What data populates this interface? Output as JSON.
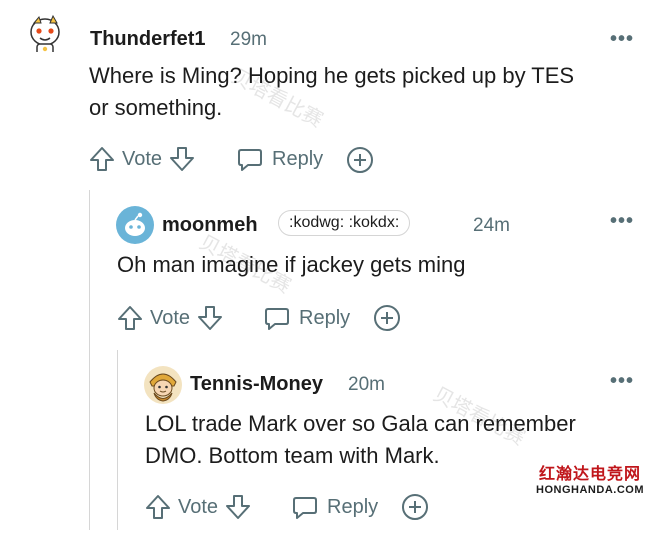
{
  "comments": [
    {
      "author": "Thunderfet1",
      "time": "29m",
      "avatar_icon": "snoo-avatar-icon",
      "text_lines": [
        "Where is Ming? Hoping he gets picked up by TES",
        "or something."
      ],
      "vote_label": "Vote",
      "reply_label": "Reply"
    },
    {
      "author": "moonmeh",
      "flair": ":kodwg: :kokdx:",
      "time": "24m",
      "avatar_icon": "default-snoo-avatar-icon",
      "text_lines": [
        "Oh man imagine if jackey gets ming"
      ],
      "vote_label": "Vote",
      "reply_label": "Reply"
    },
    {
      "author": "Tennis-Money",
      "time": "20m",
      "avatar_icon": "character-avatar-icon",
      "text_lines": [
        "LOL trade Mark over so Gala can remember",
        "DMO. Bottom team with Mark."
      ],
      "vote_label": "Vote",
      "reply_label": "Reply"
    }
  ],
  "watermarks": [
    "贝塔看比赛",
    "贝塔看比赛",
    "贝塔看比赛"
  ],
  "site_badge": {
    "name_cn": "红瀚达电竞网",
    "name_en": "HONGHANDA.COM"
  },
  "colors": {
    "text": "#1c1c1c",
    "meta": "#576f76",
    "thread": "#d6d6d6",
    "badge_red": "#c0161b"
  }
}
